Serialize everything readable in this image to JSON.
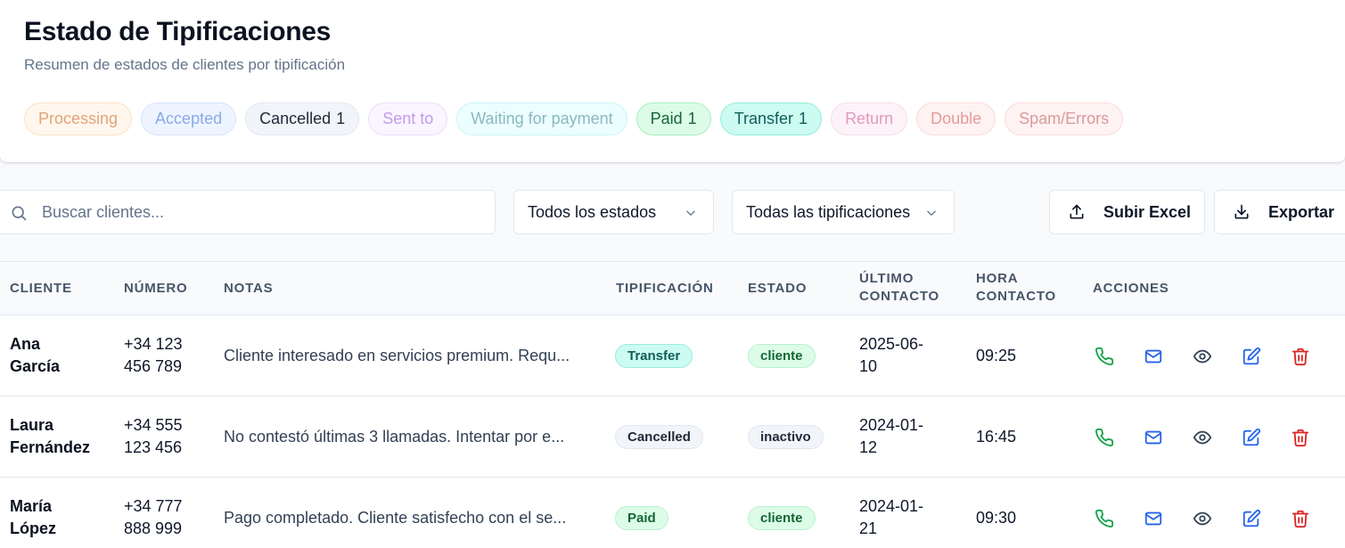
{
  "header": {
    "title": "Estado de Tipificaciones",
    "subtitle": "Resumen de estados de clientes por tipificación"
  },
  "chips": [
    {
      "label": "Processing",
      "count": "",
      "bg": "#fff7ed",
      "border": "#fde1c4",
      "color": "#e2a37a"
    },
    {
      "label": "Accepted",
      "count": "",
      "bg": "#eef4ff",
      "border": "#d7e4fd",
      "color": "#8aa9e6"
    },
    {
      "label": "Cancelled",
      "count": "1",
      "bg": "#f1f5f9",
      "border": "#e2e8f0",
      "color": "#1e293b"
    },
    {
      "label": "Sent to",
      "count": "",
      "bg": "#faf5ff",
      "border": "#ecdcfc",
      "color": "#c39be8"
    },
    {
      "label": "Waiting for payment",
      "count": "",
      "bg": "#ecfeff",
      "border": "#cdf4f8",
      "color": "#8cb8c2"
    },
    {
      "label": "Paid",
      "count": "1",
      "bg": "#dcfce7",
      "border": "#a7f0c1",
      "color": "#166534"
    },
    {
      "label": "Transfer",
      "count": "1",
      "bg": "#ccfbf1",
      "border": "#93ecd8",
      "color": "#115e59"
    },
    {
      "label": "Return",
      "count": "",
      "bg": "#fdf2f8",
      "border": "#f9dcec",
      "color": "#e199bf"
    },
    {
      "label": "Double",
      "count": "",
      "bg": "#fef2f2",
      "border": "#fbdcdc",
      "color": "#e59a9a"
    },
    {
      "label": "Spam/Errors",
      "count": "",
      "bg": "#fef2f2",
      "border": "#fbdcdc",
      "color": "#d99a9a"
    }
  ],
  "toolbar": {
    "search_placeholder": "Buscar clientes...",
    "status_filter": "Todos los estados",
    "typification_filter": "Todas las tipificaciones",
    "upload_label": "Subir Excel",
    "export_label": "Exportar"
  },
  "table": {
    "columns": [
      {
        "line1": "CLIENTE",
        "line2": ""
      },
      {
        "line1": "NÚMERO",
        "line2": ""
      },
      {
        "line1": "NOTAS",
        "line2": ""
      },
      {
        "line1": "TIPIFICACIÓN",
        "line2": ""
      },
      {
        "line1": "ESTADO",
        "line2": ""
      },
      {
        "line1": "ÚLTIMO",
        "line2": "CONTACTO"
      },
      {
        "line1": "HORA",
        "line2": "CONTACTO"
      },
      {
        "line1": "ACCIONES",
        "line2": ""
      }
    ],
    "rows": [
      {
        "name1": "Ana",
        "name2": "García",
        "phone1": "+34 123",
        "phone2": "456 789",
        "notes": "Cliente interesado en servicios premium. Requ...",
        "typification": "Transfer",
        "typ_bg": "#ccfbf1",
        "typ_border": "#99ecd9",
        "typ_color": "#115e59",
        "status": "cliente",
        "st_bg": "#dcfce7",
        "st_border": "#bbf0cf",
        "st_color": "#166534",
        "date1": "2025-06-",
        "date2": "10",
        "time": "09:25"
      },
      {
        "name1": "Laura",
        "name2": "Fernández",
        "phone1": "+34 555",
        "phone2": "123 456",
        "notes": "No contestó últimas 3 llamadas. Intentar por e...",
        "typification": "Cancelled",
        "typ_bg": "#f1f5f9",
        "typ_border": "#e2e8f0",
        "typ_color": "#1e293b",
        "status": "inactivo",
        "st_bg": "#f1f5f9",
        "st_border": "#e2e8f0",
        "st_color": "#1e293b",
        "date1": "2024-01-",
        "date2": "12",
        "time": "16:45"
      },
      {
        "name1": "María",
        "name2": "López",
        "phone1": "+34 777",
        "phone2": "888 999",
        "notes": "Pago completado. Cliente satisfecho con el se...",
        "typification": "Paid",
        "typ_bg": "#dcfce7",
        "typ_border": "#bbf0cf",
        "typ_color": "#166534",
        "status": "cliente",
        "st_bg": "#dcfce7",
        "st_border": "#bbf0cf",
        "st_color": "#166534",
        "date1": "2024-01-",
        "date2": "21",
        "time": "09:30"
      }
    ],
    "action_icons": [
      {
        "name": "phone-icon",
        "color": "#16a34a"
      },
      {
        "name": "mail-icon",
        "color": "#2563eb"
      },
      {
        "name": "eye-icon",
        "color": "#334155"
      },
      {
        "name": "edit-icon",
        "color": "#2563eb"
      },
      {
        "name": "trash-icon",
        "color": "#dc2626"
      }
    ]
  }
}
